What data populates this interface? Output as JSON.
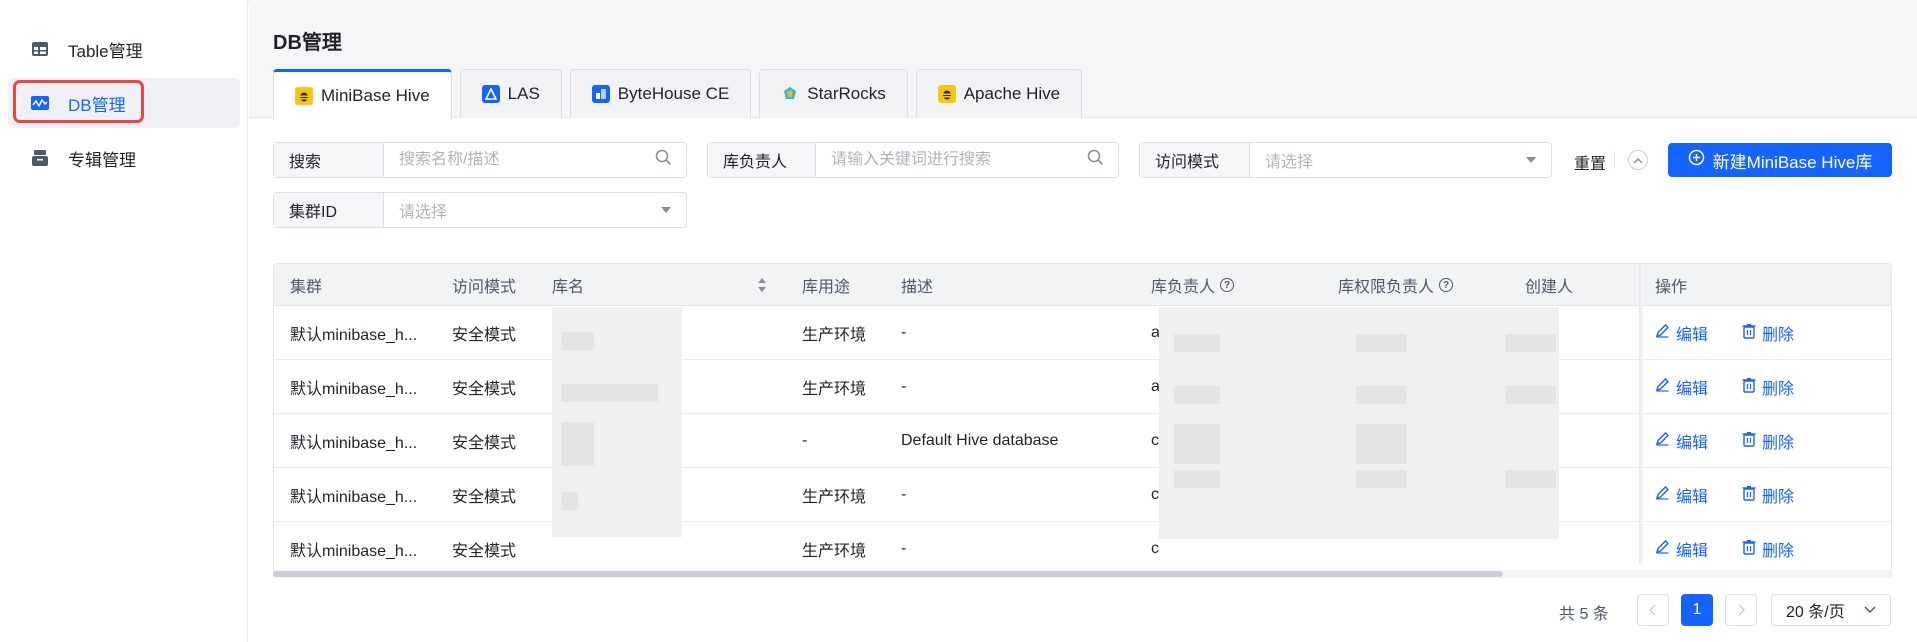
{
  "sidebar": {
    "items": [
      {
        "label": "Table管理",
        "icon": "table-icon"
      },
      {
        "label": "DB管理",
        "icon": "db-chart-icon"
      },
      {
        "label": "专辑管理",
        "icon": "album-icon"
      }
    ]
  },
  "page": {
    "title": "DB管理"
  },
  "tabs": [
    {
      "label": "MiniBase Hive"
    },
    {
      "label": "LAS"
    },
    {
      "label": "ByteHouse CE"
    },
    {
      "label": "StarRocks"
    },
    {
      "label": "Apache Hive"
    }
  ],
  "filters": {
    "search": {
      "label": "搜索",
      "placeholder": "搜索名称/描述"
    },
    "owner": {
      "label": "库负责人",
      "placeholder": "请输入关键词进行搜索"
    },
    "access_mode": {
      "label": "访问模式",
      "placeholder": "请选择"
    },
    "cluster_id": {
      "label": "集群ID",
      "placeholder": "请选择"
    },
    "reset_label": "重置",
    "create_label": "新建MiniBase Hive库"
  },
  "table": {
    "headers": {
      "cluster": "集群",
      "access_mode": "访问模式",
      "db_name": "库名",
      "usage": "库用途",
      "description": "描述",
      "owner": "库负责人",
      "perm_owner": "库权限负责人",
      "creator": "创建人",
      "actions": "操作"
    },
    "rows": [
      {
        "cluster": "默认minibase_h...",
        "access_mode": "安全模式",
        "usage": "生产环境",
        "description": "-",
        "owner_prefix": "a"
      },
      {
        "cluster": "默认minibase_h...",
        "access_mode": "安全模式",
        "usage": "生产环境",
        "description": "-",
        "owner_prefix": "a"
      },
      {
        "cluster": "默认minibase_h...",
        "access_mode": "安全模式",
        "usage": "-",
        "description": "Default Hive database",
        "owner_prefix": "c"
      },
      {
        "cluster": "默认minibase_h...",
        "access_mode": "安全模式",
        "usage": "生产环境",
        "description": "-",
        "owner_prefix": "c"
      },
      {
        "cluster": "默认minibase_h...",
        "access_mode": "安全模式",
        "usage": "生产环境",
        "description": "-",
        "owner_prefix": "c"
      }
    ],
    "edit_label": "编辑",
    "delete_label": "删除"
  },
  "pagination": {
    "total_text": "共 5 条",
    "current_page": "1",
    "page_size_label": "20 条/页"
  },
  "colors": {
    "accent": "#1664ff",
    "highlight": "#ef4444"
  }
}
